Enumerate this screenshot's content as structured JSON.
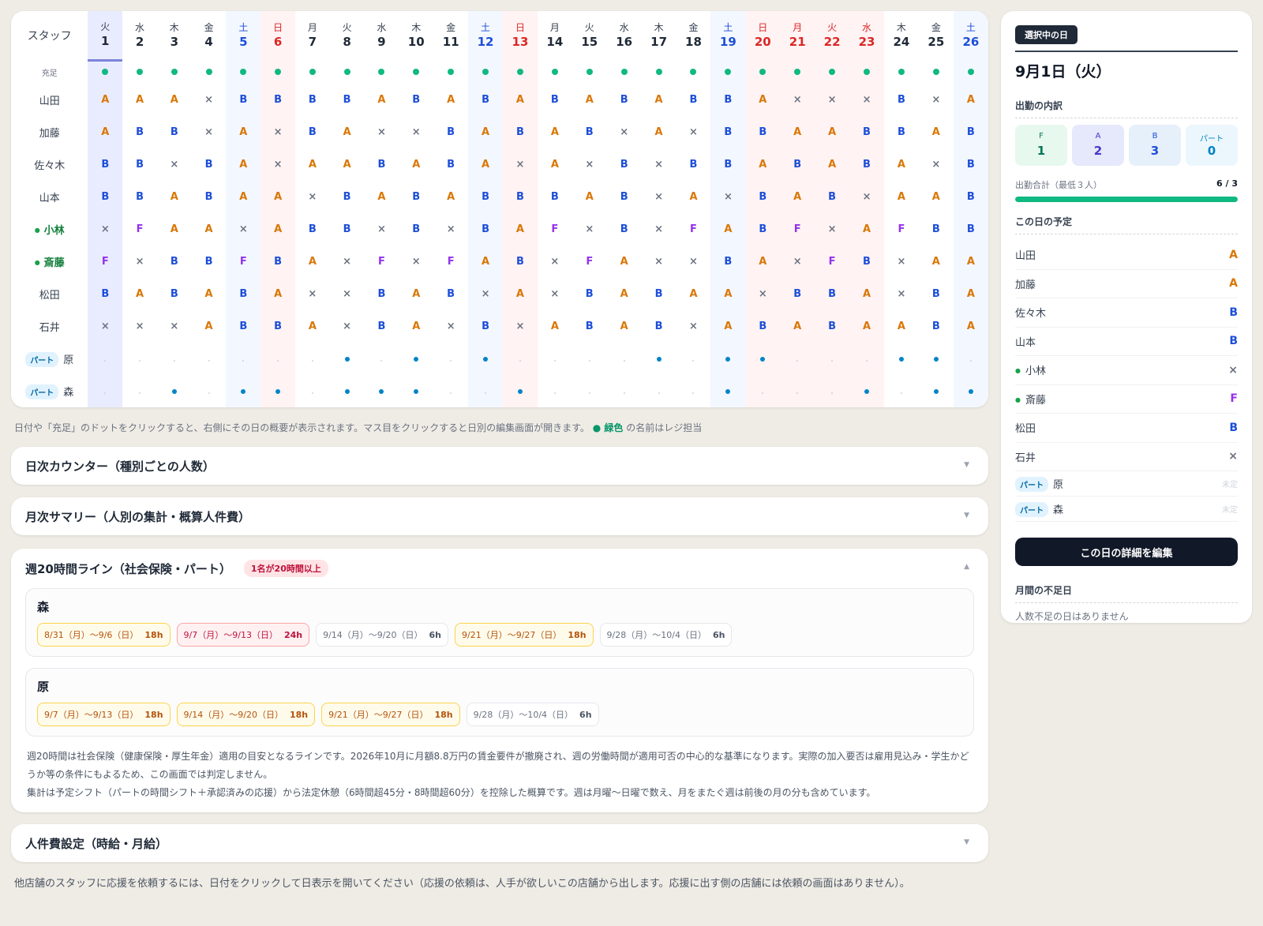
{
  "grid": {
    "staff_header": "スタッフ",
    "full_label": "充足",
    "days": [
      {
        "dow": "火",
        "d": "1",
        "t": "sel"
      },
      {
        "dow": "水",
        "d": "2",
        "t": ""
      },
      {
        "dow": "木",
        "d": "3",
        "t": ""
      },
      {
        "dow": "金",
        "d": "4",
        "t": ""
      },
      {
        "dow": "土",
        "d": "5",
        "t": "sat"
      },
      {
        "dow": "日",
        "d": "6",
        "t": "hol"
      },
      {
        "dow": "月",
        "d": "7",
        "t": ""
      },
      {
        "dow": "火",
        "d": "8",
        "t": ""
      },
      {
        "dow": "水",
        "d": "9",
        "t": ""
      },
      {
        "dow": "木",
        "d": "10",
        "t": ""
      },
      {
        "dow": "金",
        "d": "11",
        "t": ""
      },
      {
        "dow": "土",
        "d": "12",
        "t": "sat"
      },
      {
        "dow": "日",
        "d": "13",
        "t": "hol"
      },
      {
        "dow": "月",
        "d": "14",
        "t": ""
      },
      {
        "dow": "火",
        "d": "15",
        "t": ""
      },
      {
        "dow": "水",
        "d": "16",
        "t": ""
      },
      {
        "dow": "木",
        "d": "17",
        "t": ""
      },
      {
        "dow": "金",
        "d": "18",
        "t": ""
      },
      {
        "dow": "土",
        "d": "19",
        "t": "sat"
      },
      {
        "dow": "日",
        "d": "20",
        "t": "hol"
      },
      {
        "dow": "月",
        "d": "21",
        "t": "hol"
      },
      {
        "dow": "火",
        "d": "22",
        "t": "hol"
      },
      {
        "dow": "水",
        "d": "23",
        "t": "hol"
      },
      {
        "dow": "木",
        "d": "24",
        "t": ""
      },
      {
        "dow": "金",
        "d": "25",
        "t": ""
      },
      {
        "dow": "土",
        "d": "26",
        "t": "sat"
      }
    ],
    "staff": [
      {
        "name": "山田",
        "reg": false,
        "shifts": [
          "A",
          "A",
          "A",
          "×",
          "B",
          "B",
          "B",
          "B",
          "A",
          "B",
          "A",
          "B",
          "A",
          "B",
          "A",
          "B",
          "A",
          "B",
          "B",
          "A",
          "×",
          "×",
          "×",
          "B",
          "×",
          "A"
        ]
      },
      {
        "name": "加藤",
        "reg": false,
        "shifts": [
          "A",
          "B",
          "B",
          "×",
          "A",
          "×",
          "B",
          "A",
          "×",
          "×",
          "B",
          "A",
          "B",
          "A",
          "B",
          "×",
          "A",
          "×",
          "B",
          "B",
          "A",
          "A",
          "B",
          "B",
          "A",
          "B"
        ]
      },
      {
        "name": "佐々木",
        "reg": false,
        "shifts": [
          "B",
          "B",
          "×",
          "B",
          "A",
          "×",
          "A",
          "A",
          "B",
          "A",
          "B",
          "A",
          "×",
          "A",
          "×",
          "B",
          "×",
          "B",
          "B",
          "A",
          "B",
          "A",
          "B",
          "A",
          "×",
          "B"
        ]
      },
      {
        "name": "山本",
        "reg": false,
        "shifts": [
          "B",
          "B",
          "A",
          "B",
          "A",
          "A",
          "×",
          "B",
          "A",
          "B",
          "A",
          "B",
          "B",
          "B",
          "A",
          "B",
          "×",
          "A",
          "×",
          "B",
          "A",
          "B",
          "×",
          "A",
          "A",
          "B"
        ]
      },
      {
        "name": "小林",
        "reg": true,
        "shifts": [
          "×",
          "F",
          "A",
          "A",
          "×",
          "A",
          "B",
          "B",
          "×",
          "B",
          "×",
          "B",
          "A",
          "F",
          "×",
          "B",
          "×",
          "F",
          "A",
          "B",
          "F",
          "×",
          "A",
          "F",
          "B",
          "B"
        ]
      },
      {
        "name": "斎藤",
        "reg": true,
        "shifts": [
          "F",
          "×",
          "B",
          "B",
          "F",
          "B",
          "A",
          "×",
          "F",
          "×",
          "F",
          "A",
          "B",
          "×",
          "F",
          "A",
          "×",
          "×",
          "B",
          "A",
          "×",
          "F",
          "B",
          "×",
          "A",
          "A"
        ]
      },
      {
        "name": "松田",
        "reg": false,
        "shifts": [
          "B",
          "A",
          "B",
          "A",
          "B",
          "A",
          "×",
          "×",
          "B",
          "A",
          "B",
          "×",
          "A",
          "×",
          "B",
          "A",
          "B",
          "A",
          "A",
          "×",
          "B",
          "B",
          "A",
          "×",
          "B",
          "A"
        ]
      },
      {
        "name": "石井",
        "reg": false,
        "shifts": [
          "×",
          "×",
          "×",
          "A",
          "B",
          "B",
          "A",
          "×",
          "B",
          "A",
          "×",
          "B",
          "×",
          "A",
          "B",
          "A",
          "B",
          "×",
          "A",
          "B",
          "A",
          "B",
          "A",
          "A",
          "B",
          "A"
        ]
      }
    ],
    "parts": [
      {
        "tag": "パート",
        "name": "原",
        "marks": [
          0,
          0,
          0,
          0,
          0,
          0,
          0,
          1,
          0,
          1,
          0,
          1,
          0,
          0,
          0,
          0,
          1,
          0,
          1,
          1,
          0,
          0,
          0,
          1,
          1,
          0
        ]
      },
      {
        "tag": "パート",
        "name": "森",
        "marks": [
          0,
          0,
          1,
          0,
          1,
          1,
          0,
          1,
          1,
          1,
          0,
          0,
          1,
          0,
          0,
          0,
          0,
          0,
          1,
          0,
          0,
          0,
          1,
          0,
          1,
          1
        ]
      }
    ]
  },
  "help_text_a": "日付や「充足」のドットをクリックすると、右側にその日の概要が表示されます。マス目をクリックすると日別の編集画面が開きます。",
  "help_text_green": "● 緑色",
  "help_text_b": "の名前はレジ担当",
  "accordions": {
    "daily": "日次カウンター（種別ごとの人数）",
    "monthly": "月次サマリー（人別の集計・概算人件費）",
    "weekly": "週20時間ライン（社会保険・パート）",
    "weekly_warn": "1名が20時間以上",
    "labor": "人件費設定（時給・月給）"
  },
  "weekly": [
    {
      "name": "森",
      "chips": [
        {
          "range": "8/31（月）〜9/6（日）",
          "h": "18h",
          "s": "y"
        },
        {
          "range": "9/7（月）〜9/13（日）",
          "h": "24h",
          "s": "r"
        },
        {
          "range": "9/14（月）〜9/20（日）",
          "h": "6h",
          "s": ""
        },
        {
          "range": "9/21（月）〜9/27（日）",
          "h": "18h",
          "s": "y"
        },
        {
          "range": "9/28（月）〜10/4（日）",
          "h": "6h",
          "s": ""
        }
      ]
    },
    {
      "name": "原",
      "chips": [
        {
          "range": "9/7（月）〜9/13（日）",
          "h": "18h",
          "s": "y"
        },
        {
          "range": "9/14（月）〜9/20（日）",
          "h": "18h",
          "s": "y"
        },
        {
          "range": "9/21（月）〜9/27（日）",
          "h": "18h",
          "s": "y"
        },
        {
          "range": "9/28（月）〜10/4（日）",
          "h": "6h",
          "s": ""
        }
      ]
    }
  ],
  "weekly_note_1": "週20時間は社会保険（健康保険・厚生年金）適用の目安となるラインです。2026年10月に月額8.8万円の賃金要件が撤廃され、週の労働時間が適用可否の中心的な基準になります。実際の加入要否は雇用見込み・学生かどうか等の条件にもよるため、この画面では判定しません。",
  "weekly_note_2": "集計は予定シフト（パートの時間シフト＋承認済みの応援）から法定休憩（6時間超45分・8時間超60分）を控除した概算です。週は月曜〜日曜で数え、月をまたぐ週は前後の月の分も含めています。",
  "bottom_note": "他店舗のスタッフに応援を依頼するには、日付をクリックして日表示を開いてください（応援の依頼は、人手が欲しいこの店舗から出します。応援に出す側の店舗には依頼の画面はありません）。",
  "side": {
    "badge": "選択中の日",
    "date": "9月1日（火）",
    "breakdown_title": "出勤の内訳",
    "breakdown": [
      {
        "label": "F",
        "value": "1"
      },
      {
        "label": "A",
        "value": "2"
      },
      {
        "label": "B",
        "value": "3"
      },
      {
        "label": "パート",
        "value": "0"
      }
    ],
    "total_label": "出勤合計（最低３人）",
    "total_value": "6 / 3",
    "total_fill": 1.0,
    "plan_title": "この日の予定",
    "plan": [
      {
        "name": "山田",
        "v": "A",
        "reg": false
      },
      {
        "name": "加藤",
        "v": "A",
        "reg": false
      },
      {
        "name": "佐々木",
        "v": "B",
        "reg": false
      },
      {
        "name": "山本",
        "v": "B",
        "reg": false
      },
      {
        "name": "小林",
        "v": "×",
        "reg": true
      },
      {
        "name": "斎藤",
        "v": "F",
        "reg": true
      },
      {
        "name": "松田",
        "v": "B",
        "reg": false
      },
      {
        "name": "石井",
        "v": "×",
        "reg": false
      }
    ],
    "parts": [
      {
        "tag": "パート",
        "name": "原",
        "v": "未定"
      },
      {
        "tag": "パート",
        "name": "森",
        "v": "未定"
      }
    ],
    "edit_button": "この日の詳細を編集",
    "shortage_title": "月間の不足日",
    "shortage_msg": "人数不足の日はありません"
  },
  "colors": {
    "A": "#d97706",
    "B": "#1d4ed8",
    "F": "#9333ea",
    "full": "#10b981",
    "part": "#0284c7"
  }
}
